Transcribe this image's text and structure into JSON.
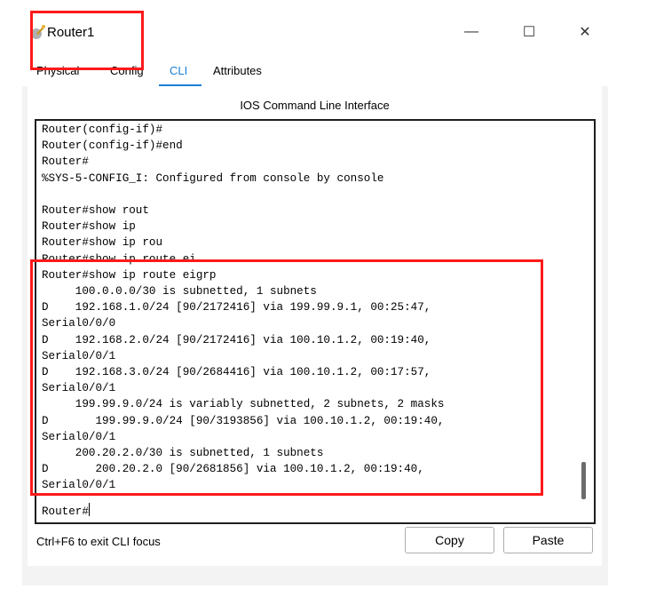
{
  "window": {
    "title": "Router1",
    "controls": {
      "minimize": "—",
      "maximize": "☐",
      "close": "✕"
    }
  },
  "tabs": [
    {
      "label": "Physical",
      "active": false
    },
    {
      "label": "Config",
      "active": false
    },
    {
      "label": "CLI",
      "active": true
    },
    {
      "label": "Attributes",
      "active": false
    }
  ],
  "panel": {
    "title": "IOS Command Line Interface"
  },
  "terminal": {
    "lines": [
      "Router(config-if)#",
      "Router(config-if)#end",
      "Router#",
      "%SYS-5-CONFIG_I: Configured from console by console",
      "",
      "Router#show rout",
      "Router#show ip",
      "Router#show ip rou",
      "Router#show ip route ei",
      "Router#show ip route eigrp",
      "     100.0.0.0/30 is subnetted, 1 subnets",
      "D    192.168.1.0/24 [90/2172416] via 199.99.9.1, 00:25:47,",
      "Serial0/0/0",
      "D    192.168.2.0/24 [90/2172416] via 100.10.1.2, 00:19:40,",
      "Serial0/0/1",
      "D    192.168.3.0/24 [90/2684416] via 100.10.1.2, 00:17:57,",
      "Serial0/0/1",
      "     199.99.9.0/24 is variably subnetted, 2 subnets, 2 masks",
      "D       199.99.9.0/24 [90/3193856] via 100.10.1.2, 00:19:40,",
      "Serial0/0/1",
      "     200.20.2.0/30 is subnetted, 1 subnets",
      "D       200.20.2.0 [90/2681856] via 100.10.1.2, 00:19:40,",
      "Serial0/0/1"
    ],
    "prompt": "Router#"
  },
  "footer": {
    "hint": "Ctrl+F6 to exit CLI focus",
    "copy_label": "Copy",
    "paste_label": "Paste"
  },
  "colors": {
    "accent": "#1a7fd4",
    "highlight": "#ff1a1a",
    "background": "#f3f3f3"
  }
}
